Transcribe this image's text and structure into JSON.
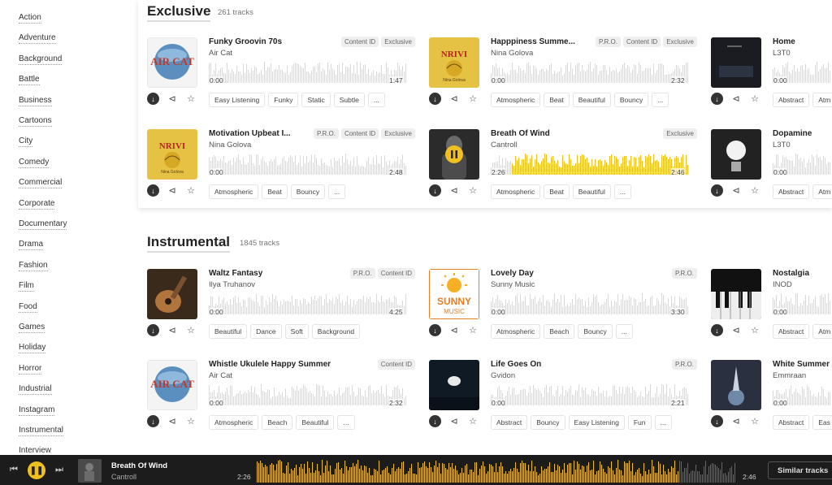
{
  "sidebar": {
    "items": [
      "Action",
      "Adventure",
      "Background",
      "Battle",
      "Business",
      "Cartoons",
      "City",
      "Comedy",
      "Commercial",
      "Corporate",
      "Documentary",
      "Drama",
      "Fashion",
      "Film",
      "Food",
      "Games",
      "Holiday",
      "Horror",
      "Industrial",
      "Instagram",
      "Instrumental",
      "Interview"
    ]
  },
  "sections": [
    {
      "title": "Exclusive",
      "count": "261 tracks",
      "tracks": [
        {
          "title": "Funky Groovin 70s",
          "artist": "Air Cat",
          "badges": [
            "Content ID",
            "Exclusive"
          ],
          "start": "0:00",
          "end": "1:47",
          "tags": [
            "Easy Listening",
            "Funky",
            "Static",
            "Subtle",
            "..."
          ],
          "cover": "aircat"
        },
        {
          "title": "Happpiness Summe...",
          "artist": "Nina Golova",
          "badges": [
            "P.R.O.",
            "Content ID",
            "Exclusive"
          ],
          "start": "0:00",
          "end": "2:32",
          "tags": [
            "Atmospheric",
            "Beat",
            "Beautiful",
            "Bouncy",
            "..."
          ],
          "cover": "nina"
        },
        {
          "title": "Home",
          "artist": "L3T0",
          "badges": [],
          "start": "0:00",
          "end": "",
          "tags": [
            "Abstract",
            "Atm"
          ],
          "cover": "dark"
        },
        {
          "title": "Motivation Upbeat I...",
          "artist": "Nina Golova",
          "badges": [
            "P.R.O.",
            "Content ID",
            "Exclusive"
          ],
          "start": "0:00",
          "end": "2:48",
          "tags": [
            "Atmospheric",
            "Beat",
            "Bouncy",
            "..."
          ],
          "cover": "nina"
        },
        {
          "title": "Breath Of Wind",
          "artist": "Cantroll",
          "badges": [
            "Exclusive"
          ],
          "start": "2:26",
          "end": "2:46",
          "tags": [
            "Atmospheric",
            "Beat",
            "Beautiful",
            "..."
          ],
          "cover": "knight",
          "playing": true
        },
        {
          "title": "Dopamine",
          "artist": "L3T0",
          "badges": [],
          "start": "0:00",
          "end": "",
          "tags": [
            "Abstract",
            "Atm"
          ],
          "cover": "lamp"
        }
      ]
    },
    {
      "title": "Instrumental",
      "count": "1845 tracks",
      "tracks": [
        {
          "title": "Waltz Fantasy",
          "artist": "Ilya Truhanov",
          "badges": [
            "P.R.O.",
            "Content ID"
          ],
          "start": "0:00",
          "end": "4:25",
          "tags": [
            "Beautiful",
            "Dance",
            "Soft",
            "Background"
          ],
          "cover": "guitar"
        },
        {
          "title": "Lovely Day",
          "artist": "Sunny Music",
          "badges": [
            "P.R.O."
          ],
          "start": "0:00",
          "end": "3:30",
          "tags": [
            "Atmospheric",
            "Beach",
            "Bouncy",
            "..."
          ],
          "cover": "sunny"
        },
        {
          "title": "Nostalgia",
          "artist": "INOD",
          "badges": [],
          "start": "0:00",
          "end": "",
          "tags": [
            "Abstract",
            "Atm"
          ],
          "cover": "piano"
        },
        {
          "title": "Whistle Ukulele Happy Summer",
          "artist": "Air Cat",
          "badges": [
            "Content ID"
          ],
          "start": "0:00",
          "end": "2:32",
          "tags": [
            "Atmospheric",
            "Beach",
            "Beautiful",
            "..."
          ],
          "cover": "aircat"
        },
        {
          "title": "Life Goes On",
          "artist": "Gvidon",
          "badges": [
            "P.R.O."
          ],
          "start": "0:00",
          "end": "2:21",
          "tags": [
            "Abstract",
            "Bouncy",
            "Easy Listening",
            "Fun",
            "..."
          ],
          "cover": "lifegoes"
        },
        {
          "title": "White Summer",
          "artist": "Emmraan",
          "badges": [],
          "start": "0:00",
          "end": "",
          "tags": [
            "Abstract",
            "Eas"
          ],
          "cover": "space"
        }
      ]
    }
  ],
  "player": {
    "title": "Breath Of Wind",
    "artist": "Cantroll",
    "current_time": "2:26",
    "duration": "2:46",
    "progress": 0.88,
    "similar_label": "Similar tracks"
  },
  "icons": {
    "download": "download-icon",
    "share": "share-icon",
    "favorite": "star-icon",
    "prev": "skip-back-icon",
    "next": "skip-forward-icon",
    "pause": "pause-icon"
  },
  "colors": {
    "accent": "#f0c020",
    "player_bg": "#1c1c1c"
  }
}
